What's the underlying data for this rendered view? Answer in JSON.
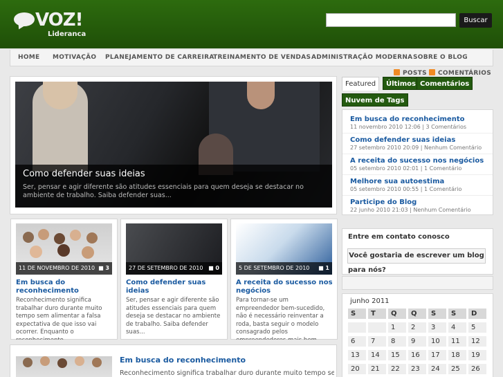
{
  "header": {
    "logo_text": "VOZ!",
    "logo_sub": "Lideranca",
    "search_placeholder": "",
    "search_button": "Buscar"
  },
  "nav": [
    "HOME",
    "MOTIVAÇÃO",
    "PLANEJAMENTO DE CARREIRA",
    "TREINAMENTO DE VENDAS",
    "ADMINISTRAÇÃO MODERNA",
    "SOBRE O BLOG"
  ],
  "feeds": {
    "posts": "POSTS",
    "comments": "COMENTÁRIOS"
  },
  "slider": {
    "title": "Como defender suas ideias",
    "excerpt": "Ser, pensar e agir diferente são atitudes essenciais para quem deseja se destacar no ambiente de trabalho. Saiba defender suas..."
  },
  "posts": [
    {
      "date": "11 DE NOVEMBRO DE 2010",
      "comments": "3",
      "title": "Em busca do reconhecimento",
      "excerpt": "Reconhecimento significa trabalhar duro durante muito tempo sem alimentar a falsa expectativa de que isso vai ocorrer. Enquanto o reconhecimento..."
    },
    {
      "date": "27 DE SETEMBRO DE 2010",
      "comments": "0",
      "title": "Como defender suas ideias",
      "excerpt": "Ser, pensar e agir diferente são atitudes essenciais para quem deseja se destacar no ambiente de trabalho. Saiba defender suas..."
    },
    {
      "date": "5 DE SETEMBRO DE 2010",
      "comments": "1",
      "title": "A receita do sucesso nos negócios",
      "excerpt": "Para tornar-se um empreendedor bem-sucedido, não é necessário reinventar a roda, basta seguir o modelo consagrado pelos empreendedores mais bem-sucedidos..."
    }
  ],
  "bottom_post": {
    "title": "Em busca do reconhecimento",
    "excerpt": "Reconhecimento significa trabalhar duro durante muito tempo sem"
  },
  "tabs": [
    "Featured",
    "Últimos",
    "Comentários",
    "Nuvem de Tags"
  ],
  "featured": [
    {
      "title": "Em busca do reconhecimento",
      "meta": "11 novembro 2010 12:06 | 3 Comentários"
    },
    {
      "title": "Como defender suas ideias",
      "meta": "27 setembro 2010 20:09 | Nenhum Comentário"
    },
    {
      "title": "A receita do sucesso nos negócios",
      "meta": "05 setembro 2010 02:01 | 1 Comentário"
    },
    {
      "title": "Melhore sua autoestima",
      "meta": "05 setembro 2010 00:55 | 1 Comentário"
    },
    {
      "title": "Participe do Blog",
      "meta": "22 junho 2010 21:03 | Nenhum Comentário"
    }
  ],
  "contact": {
    "title": "Entre em contato conosco",
    "button": "Você gostaria de escrever um blog",
    "question": "para nós?"
  },
  "calendar": {
    "caption": "junho 2011",
    "days": [
      "S",
      "T",
      "Q",
      "Q",
      "S",
      "S",
      "D"
    ],
    "weeks": [
      [
        "",
        "",
        "1",
        "2",
        "3",
        "4",
        "5"
      ],
      [
        "6",
        "7",
        "8",
        "9",
        "10",
        "11",
        "12"
      ],
      [
        "13",
        "14",
        "15",
        "16",
        "17",
        "18",
        "19"
      ],
      [
        "20",
        "21",
        "22",
        "23",
        "24",
        "25",
        "26"
      ]
    ]
  },
  "colors": {
    "header_green": "#2d6b0e",
    "link_blue": "#1a5aa0",
    "tab_green": "#245a10"
  }
}
